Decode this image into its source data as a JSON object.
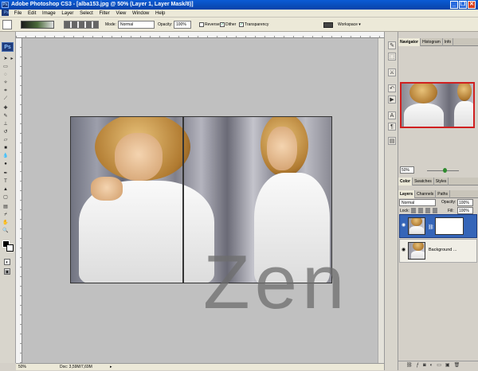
{
  "window": {
    "title": "Adobe Photoshop CS3 - [alba153.jpg @ 50% (Layer 1, Layer Mask/8)]",
    "app_icon": "Ps"
  },
  "window_controls": {
    "minimize": "_",
    "restore": "❐",
    "close": "✕"
  },
  "menu": [
    "File",
    "Edit",
    "Image",
    "Layer",
    "Select",
    "Filter",
    "View",
    "Window",
    "Help"
  ],
  "options_bar": {
    "mode_label": "Mode:",
    "mode_value": "Normal",
    "opacity_label": "Opacity:",
    "opacity_value": "100%",
    "reverse_label": "Reverse",
    "dither_label": "Dither",
    "transparency_label": "Transparency",
    "workspace_label": "Workspace"
  },
  "toolbox": {
    "logo": "Ps"
  },
  "canvas": {
    "watermark_text": "Zen"
  },
  "status_bar": {
    "zoom": "50%",
    "doc_info": "Doc: 3,59M/7,69M"
  },
  "navigator_panel": {
    "tabs": [
      "Navigator",
      "Histogram",
      "Info"
    ],
    "zoom_value": "50%"
  },
  "color_panel": {
    "tabs": [
      "Color",
      "Swatches",
      "Styles"
    ]
  },
  "layers_panel": {
    "tabs": [
      "Layers",
      "Channels",
      "Paths"
    ],
    "blend_mode": "Normal",
    "opacity_label": "Opacity:",
    "opacity_value": "100%",
    "lock_label": "Lock:",
    "fill_label": "Fill:",
    "fill_value": "100%",
    "layers": [
      {
        "name": "",
        "selected": true
      },
      {
        "name": "Background ...",
        "selected": false
      }
    ]
  },
  "colors": {
    "title_bar": "#0a5bd6",
    "selected_layer": "#3565b8",
    "canvas_bg": "#c0c0c0"
  }
}
